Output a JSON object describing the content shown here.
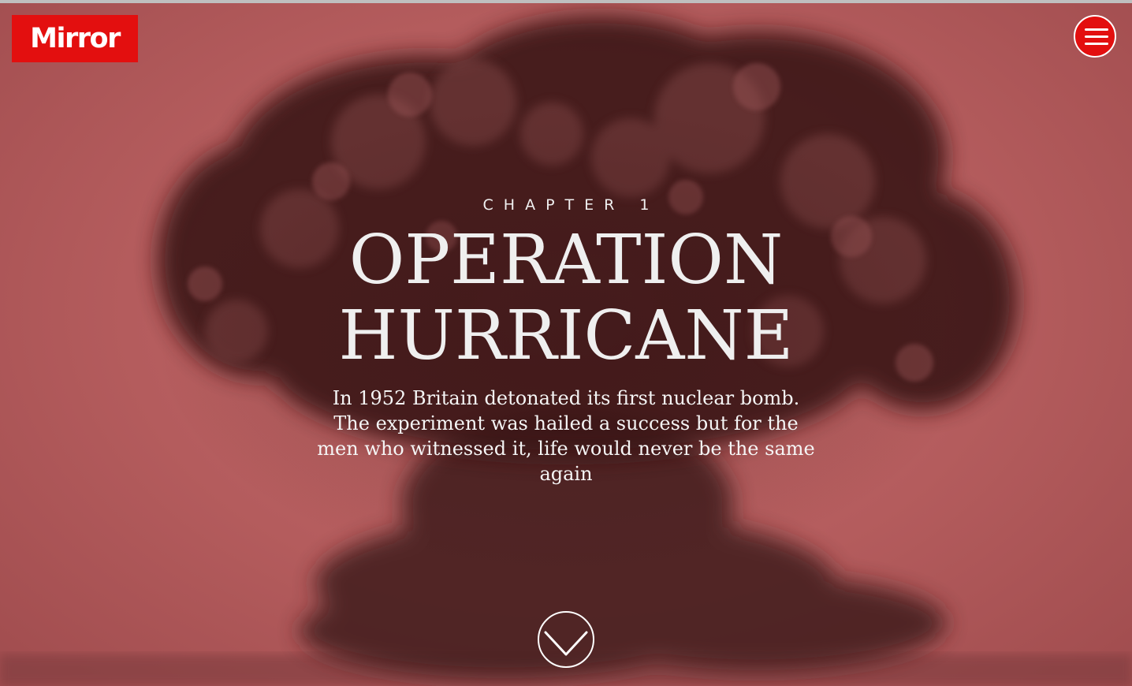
{
  "header": {
    "logo_text": "Mirror",
    "menu_icon": "hamburger-menu-icon",
    "brand_color": "#e30f0f"
  },
  "hero": {
    "kicker": "CHAPTER 1",
    "title_line_1": "OPERATION",
    "title_line_2": "HURRICANE",
    "standfirst": "In 1952 Britain detonated its first nuclear bomb. The experiment was hailed a success but for the men who witnessed it, life would never be the same again",
    "background_tint": "#b45c5d",
    "background_image": "nuclear mushroom cloud photograph tinted red"
  },
  "scroll": {
    "icon": "chevron-down-icon"
  }
}
